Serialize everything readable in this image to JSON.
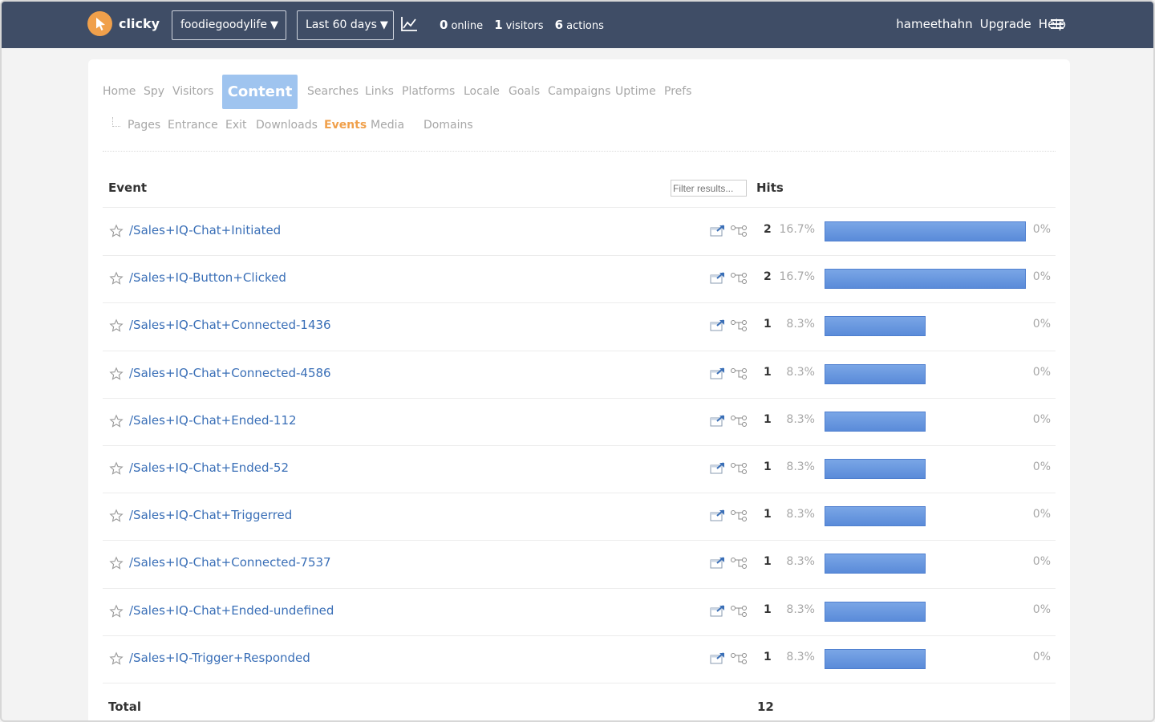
{
  "header": {
    "brand": "clicky",
    "site_selector": "foodiegoodylife",
    "range_selector": "Last 60 days",
    "stats": [
      {
        "value": "0",
        "label": "online"
      },
      {
        "value": "1",
        "label": "visitors"
      },
      {
        "value": "6",
        "label": "actions"
      }
    ],
    "user": "hameethahn",
    "upgrade": "Upgrade",
    "help": "Help",
    "colors": {
      "bar": "#3f4d66",
      "logo": "#f0a04b"
    }
  },
  "main_nav": {
    "items": [
      "Home",
      "Spy",
      "Visitors",
      "Content",
      "Searches",
      "Links",
      "Platforms",
      "Locale",
      "Goals",
      "Campaigns",
      "Uptime",
      "Prefs"
    ],
    "active": "Content"
  },
  "sub_nav": {
    "items": [
      "Pages",
      "Entrance",
      "Exit",
      "Downloads",
      "Events",
      "Media",
      "Domains"
    ],
    "active": "Events"
  },
  "table": {
    "col_event": "Event",
    "filter_placeholder": "Filter results...",
    "col_hits": "Hits",
    "rows": [
      {
        "event": "/Sales+IQ-Chat+Initiated",
        "hits": "2",
        "percent": "16.7%",
        "share": 1.0,
        "change": "0%"
      },
      {
        "event": "/Sales+IQ-Button+Clicked",
        "hits": "2",
        "percent": "16.7%",
        "share": 1.0,
        "change": "0%"
      },
      {
        "event": "/Sales+IQ-Chat+Connected-1436",
        "hits": "1",
        "percent": "8.3%",
        "share": 0.5,
        "change": "0%"
      },
      {
        "event": "/Sales+IQ-Chat+Connected-4586",
        "hits": "1",
        "percent": "8.3%",
        "share": 0.5,
        "change": "0%"
      },
      {
        "event": "/Sales+IQ-Chat+Ended-112",
        "hits": "1",
        "percent": "8.3%",
        "share": 0.5,
        "change": "0%"
      },
      {
        "event": "/Sales+IQ-Chat+Ended-52",
        "hits": "1",
        "percent": "8.3%",
        "share": 0.5,
        "change": "0%"
      },
      {
        "event": "/Sales+IQ-Chat+Triggerred",
        "hits": "1",
        "percent": "8.3%",
        "share": 0.5,
        "change": "0%"
      },
      {
        "event": "/Sales+IQ-Chat+Connected-7537",
        "hits": "1",
        "percent": "8.3%",
        "share": 0.5,
        "change": "0%"
      },
      {
        "event": "/Sales+IQ-Chat+Ended-undefined",
        "hits": "1",
        "percent": "8.3%",
        "share": 0.5,
        "change": "0%"
      },
      {
        "event": "/Sales+IQ-Trigger+Responded",
        "hits": "1",
        "percent": "8.3%",
        "share": 0.5,
        "change": "0%"
      }
    ],
    "total_label": "Total",
    "total_value": "12"
  },
  "icons": {
    "row_action_1": "open-in-new-window-icon",
    "row_action_2": "visitor-path-icon",
    "favorite": "star-outline-icon",
    "chart": "line-chart-icon",
    "menu": "hamburger-menu-icon"
  }
}
